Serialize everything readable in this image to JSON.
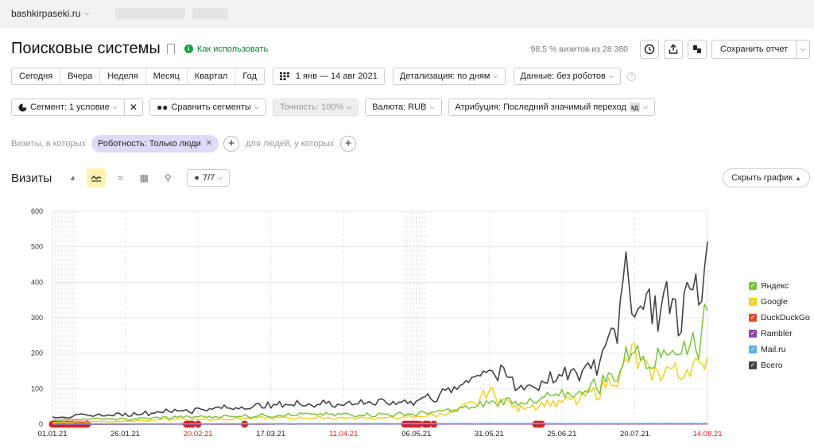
{
  "topbar": {
    "site": "bashkirpaseki.ru"
  },
  "header": {
    "title": "Поисковые системы",
    "howto": "Как использовать",
    "visits_share": "98,5 % визитов из 28 380",
    "save_label": "Сохранить отчет"
  },
  "period_buttons": [
    "Сегодня",
    "Вчера",
    "Неделя",
    "Месяц",
    "Квартал",
    "Год"
  ],
  "toolbar": {
    "date_range": "1 янв — 14 авг 2021",
    "detail": "Детализация: по дням",
    "data": "Данные: без роботов"
  },
  "segment_bar": {
    "segment": "Сегмент: 1 условие",
    "compare": "Сравнить сегменты",
    "accuracy": "Точность: 100%",
    "currency": "Валюта: RUB",
    "attribution": "Атрибуция: Последний значимый переход",
    "attribution_badge": "кд"
  },
  "filters": {
    "prefix": "Визиты, в которых",
    "pill": "Роботность: Только люди",
    "suffix": "для людей, у которых"
  },
  "chart_header": {
    "title": "Визиты",
    "series_count": "7/7",
    "hide_label": "Скрыть график"
  },
  "colors": {
    "yandex": "#7cc243",
    "google": "#f2d026",
    "duckduckgo": "#e34a2f",
    "rambler": "#8e44ad",
    "mailru": "#5aaee0",
    "total": "#444444",
    "accent_green": "#1a9e3c",
    "marker_red": "#e01f1f"
  },
  "chart_data": {
    "type": "line",
    "ylim": [
      0,
      600
    ],
    "yticks": [
      0,
      100,
      200,
      300,
      400,
      500,
      600
    ],
    "xticks": [
      {
        "label": "01.01.21",
        "day": 0,
        "holiday": false
      },
      {
        "label": "26.01.21",
        "day": 25,
        "holiday": false
      },
      {
        "label": "20.02.21",
        "day": 50,
        "holiday": true
      },
      {
        "label": "17.03.21",
        "day": 75,
        "holiday": false
      },
      {
        "label": "11.04.21",
        "day": 100,
        "holiday": true
      },
      {
        "label": "06.05.21",
        "day": 125,
        "holiday": false
      },
      {
        "label": "31.05.21",
        "day": 150,
        "holiday": false
      },
      {
        "label": "25.06.21",
        "day": 175,
        "holiday": false
      },
      {
        "label": "20.07.21",
        "day": 200,
        "holiday": false
      },
      {
        "label": "14.08.21",
        "day": 225,
        "holiday": true
      }
    ],
    "days": 226,
    "series": [
      {
        "name": "Яндекс",
        "key": "yandex",
        "anchors": [
          [
            0,
            12
          ],
          [
            10,
            15
          ],
          [
            25,
            14
          ],
          [
            40,
            20
          ],
          [
            55,
            22
          ],
          [
            70,
            25
          ],
          [
            85,
            28
          ],
          [
            100,
            28
          ],
          [
            115,
            28
          ],
          [
            125,
            30
          ],
          [
            135,
            38
          ],
          [
            145,
            50
          ],
          [
            150,
            62
          ],
          [
            160,
            70
          ],
          [
            165,
            60
          ],
          [
            170,
            78
          ],
          [
            180,
            90
          ],
          [
            188,
            120
          ],
          [
            193,
            140
          ],
          [
            197,
            190
          ],
          [
            200,
            230
          ],
          [
            205,
            180
          ],
          [
            210,
            220
          ],
          [
            215,
            210
          ],
          [
            220,
            240
          ],
          [
            223,
            260
          ],
          [
            225,
            320
          ]
        ]
      },
      {
        "name": "Google",
        "key": "google",
        "anchors": [
          [
            0,
            5
          ],
          [
            10,
            7
          ],
          [
            25,
            8
          ],
          [
            40,
            15
          ],
          [
            55,
            14
          ],
          [
            70,
            18
          ],
          [
            85,
            18
          ],
          [
            100,
            18
          ],
          [
            115,
            18
          ],
          [
            125,
            22
          ],
          [
            135,
            30
          ],
          [
            140,
            45
          ],
          [
            145,
            60
          ],
          [
            150,
            95
          ],
          [
            155,
            70
          ],
          [
            160,
            45
          ],
          [
            165,
            55
          ],
          [
            170,
            60
          ],
          [
            180,
            70
          ],
          [
            188,
            100
          ],
          [
            195,
            145
          ],
          [
            200,
            210
          ],
          [
            205,
            140
          ],
          [
            210,
            160
          ],
          [
            215,
            150
          ],
          [
            220,
            165
          ],
          [
            223,
            175
          ],
          [
            225,
            190
          ]
        ]
      },
      {
        "name": "DuckDuckGo",
        "key": "duckduckgo",
        "anchors": [
          [
            0,
            0
          ],
          [
            225,
            1
          ]
        ]
      },
      {
        "name": "Rambler",
        "key": "rambler",
        "anchors": [
          [
            0,
            0
          ],
          [
            225,
            1
          ]
        ]
      },
      {
        "name": "Mail.ru",
        "key": "mailru",
        "anchors": [
          [
            0,
            1
          ],
          [
            225,
            2
          ]
        ]
      },
      {
        "name": "Всего",
        "key": "total",
        "anchors": [
          [
            0,
            20
          ],
          [
            10,
            25
          ],
          [
            25,
            28
          ],
          [
            40,
            38
          ],
          [
            55,
            45
          ],
          [
            70,
            52
          ],
          [
            85,
            60
          ],
          [
            100,
            60
          ],
          [
            110,
            65
          ],
          [
            115,
            60
          ],
          [
            125,
            70
          ],
          [
            135,
            90
          ],
          [
            140,
            110
          ],
          [
            145,
            150
          ],
          [
            150,
            160
          ],
          [
            155,
            140
          ],
          [
            160,
            110
          ],
          [
            165,
            110
          ],
          [
            170,
            130
          ],
          [
            180,
            145
          ],
          [
            188,
            190
          ],
          [
            191,
            280
          ],
          [
            194,
            300
          ],
          [
            197,
            420
          ],
          [
            200,
            340
          ],
          [
            203,
            380
          ],
          [
            206,
            330
          ],
          [
            210,
            360
          ],
          [
            215,
            330
          ],
          [
            220,
            380
          ],
          [
            223,
            400
          ],
          [
            225,
            515
          ]
        ]
      }
    ]
  }
}
